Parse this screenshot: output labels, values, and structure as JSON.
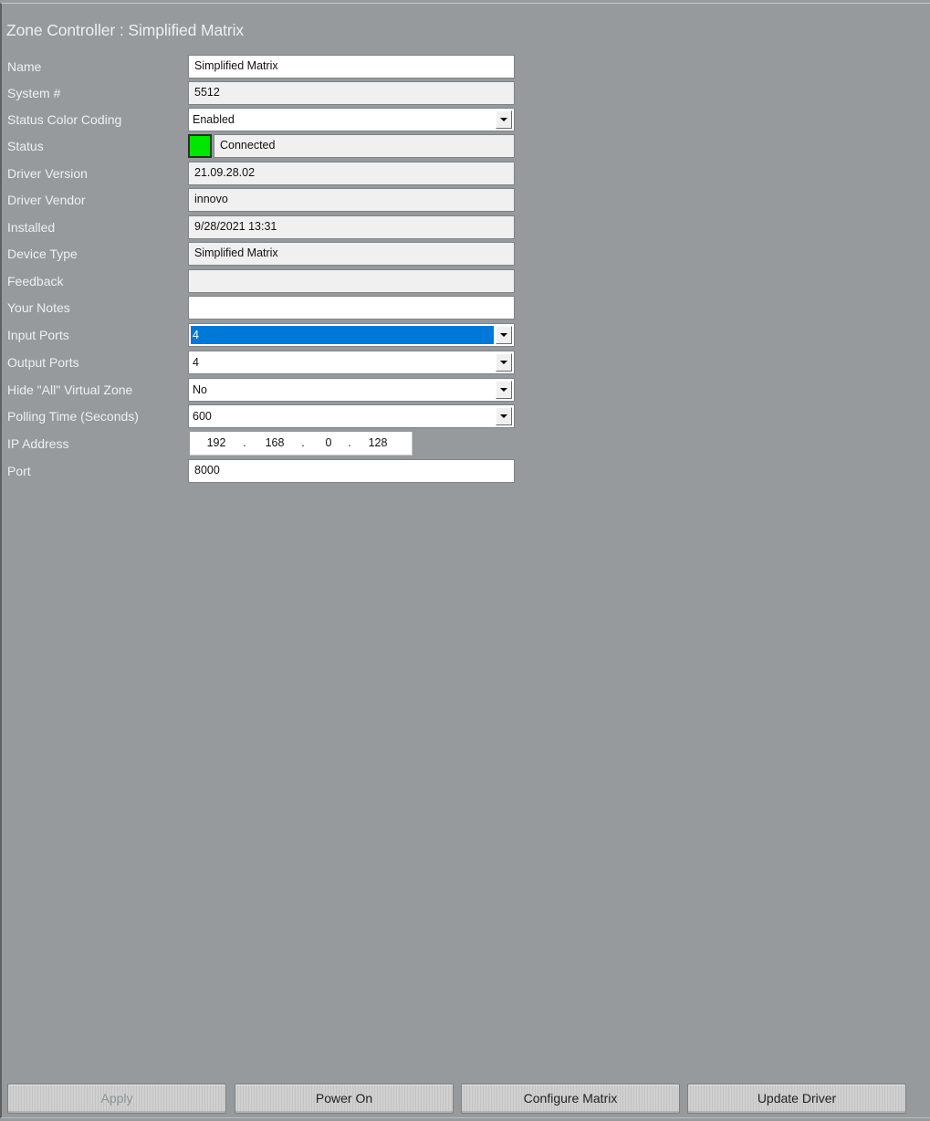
{
  "title": "Zone Controller : Simplified Matrix",
  "fields": {
    "name": {
      "label": "Name",
      "value": "Simplified Matrix"
    },
    "system_number": {
      "label": "System #",
      "value": "5512"
    },
    "status_color_coding": {
      "label": "Status Color Coding",
      "value": "Enabled"
    },
    "status": {
      "label": "Status",
      "value": "Connected",
      "color": "#00e600"
    },
    "driver_version": {
      "label": "Driver Version",
      "value": "21.09.28.02"
    },
    "driver_vendor": {
      "label": "Driver Vendor",
      "value": "innovo"
    },
    "installed": {
      "label": "Installed",
      "value": "9/28/2021 13:31"
    },
    "device_type": {
      "label": "Device Type",
      "value": "Simplified Matrix"
    },
    "feedback": {
      "label": "Feedback",
      "value": ""
    },
    "your_notes": {
      "label": "Your Notes",
      "value": ""
    },
    "input_ports": {
      "label": "Input Ports",
      "value": "4"
    },
    "output_ports": {
      "label": "Output Ports",
      "value": "4"
    },
    "hide_all_virtual_zone": {
      "label": "Hide \"All\" Virtual Zone",
      "value": "No"
    },
    "polling_time": {
      "label": "Polling Time (Seconds)",
      "value": "600"
    },
    "ip_address": {
      "label": "IP Address",
      "octets": [
        "192",
        "168",
        "0",
        "128"
      ],
      "separator": "."
    },
    "port": {
      "label": "Port",
      "value": "8000"
    }
  },
  "buttons": {
    "apply": {
      "label": "Apply",
      "enabled": false
    },
    "power_on": {
      "label": "Power On",
      "enabled": true
    },
    "configure_matrix": {
      "label": "Configure Matrix",
      "enabled": true
    },
    "update_driver": {
      "label": "Update Driver",
      "enabled": true
    }
  }
}
